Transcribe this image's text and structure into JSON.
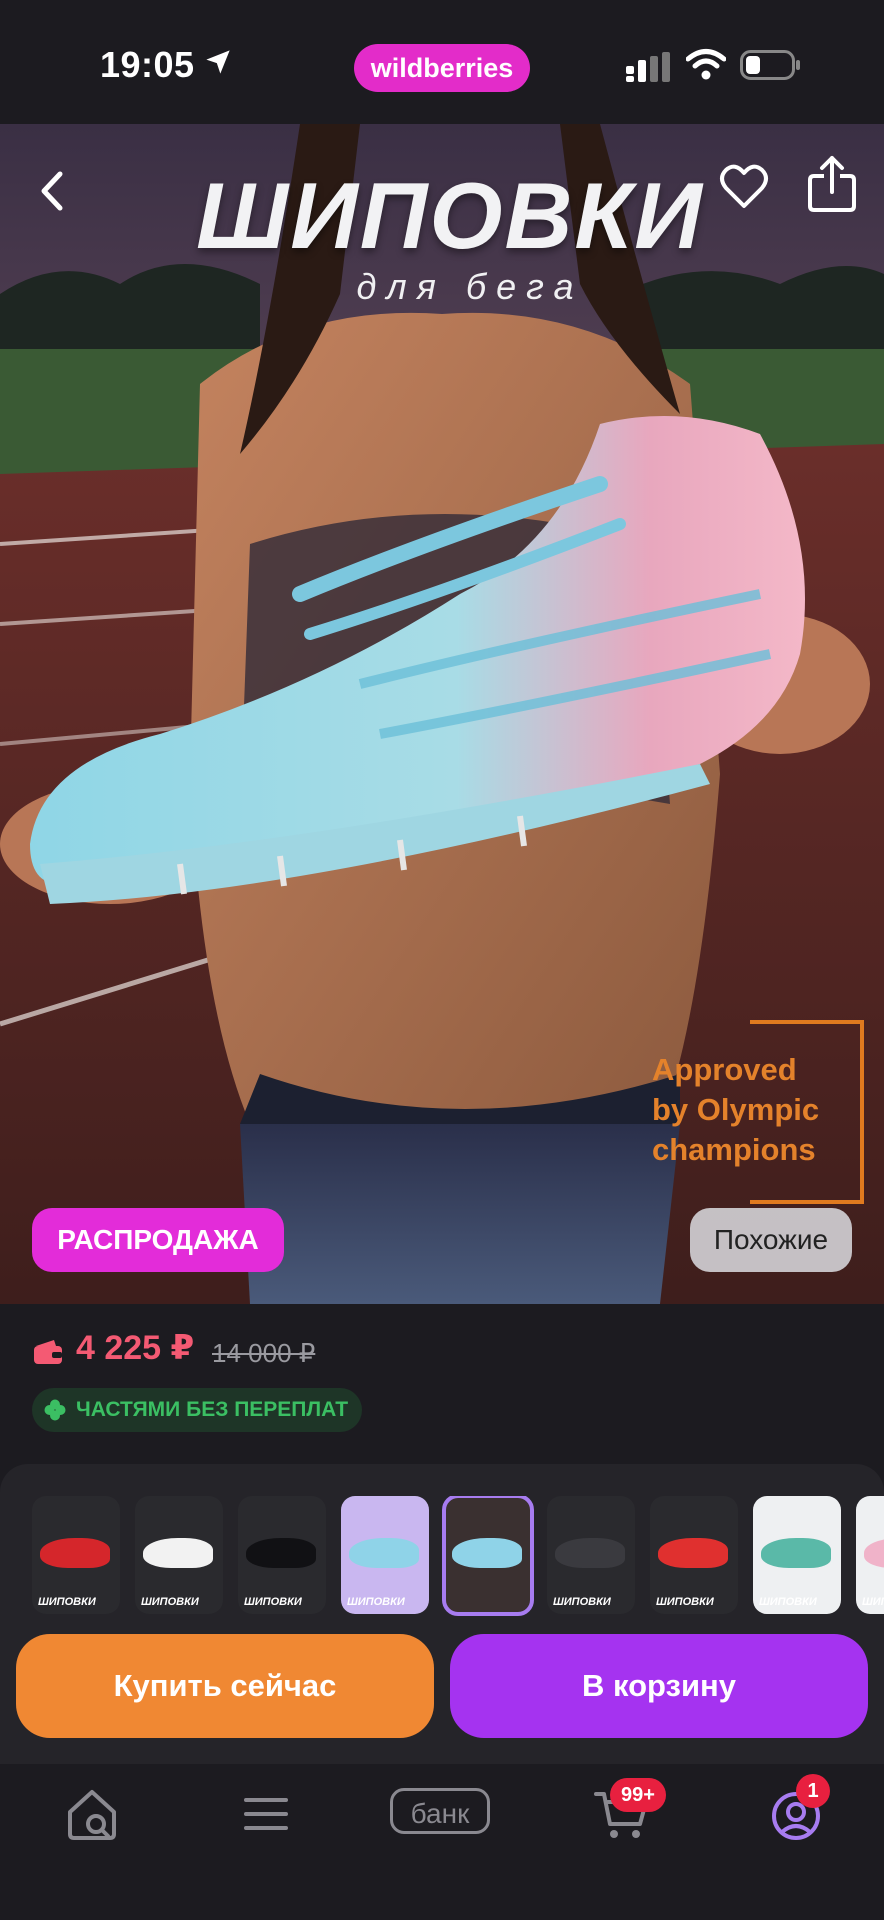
{
  "status_bar": {
    "time": "19:05",
    "brand": "wildberries"
  },
  "hero": {
    "title": "ШИПОВКИ",
    "subtitle": "для бега",
    "olympic_lines": [
      "Approved",
      "by Olympic",
      "champions"
    ],
    "sale_label": "РАСПРОДАЖА",
    "similar_label": "Похожие"
  },
  "price": {
    "current": "4 225 ₽",
    "old": "14 000 ₽",
    "installment": "ЧАСТЯМИ БЕЗ ПЕРЕПЛАТ"
  },
  "gallery": {
    "thumbs": [
      {
        "caption": "ШИПОВКИ",
        "bg": "#2a2a2e",
        "shoe": "#d5262b"
      },
      {
        "caption": "ШИПОВКИ",
        "bg": "#2a2a2e",
        "shoe": "#f2f2f2"
      },
      {
        "caption": "ШИПОВКИ",
        "bg": "#2a2a2e",
        "shoe": "#111114"
      },
      {
        "caption": "ШИПОВКИ",
        "bg": "#c9b7f0",
        "shoe": "#8fd3e8"
      },
      {
        "caption": "",
        "bg": "#3a3030",
        "shoe": "#8fd3e8"
      },
      {
        "caption": "ШИПОВКИ",
        "bg": "#2a2a2e",
        "shoe": "#3a3a3f"
      },
      {
        "caption": "ШИПОВКИ",
        "bg": "#2a2a2e",
        "shoe": "#e0302f"
      },
      {
        "caption": "ШИПОВКИ",
        "bg": "#eef0f2",
        "shoe": "#5ab9a8"
      },
      {
        "caption": "ШИПОВКИ",
        "bg": "#eef0f2",
        "shoe": "#f0b3c9"
      }
    ],
    "active_index": 4
  },
  "actions": {
    "buy_now": "Купить сейчас",
    "add_to_cart": "В корзину"
  },
  "tab_bar": {
    "bank_label": "банк",
    "cart_badge": "99+",
    "profile_badge": "1"
  },
  "colors": {
    "accent_pink": "#e32cd9",
    "price_red": "#f45a73",
    "buy_orange": "#f08833",
    "cart_purple": "#a533f0",
    "installment_green": "#3bbf63"
  }
}
